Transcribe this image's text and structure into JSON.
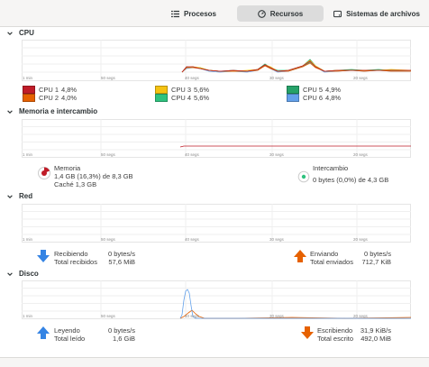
{
  "tabs": [
    {
      "label": "Procesos",
      "icon": "list-icon"
    },
    {
      "label": "Recursos",
      "icon": "gauge-icon"
    },
    {
      "label": "Sistemas de archivos",
      "icon": "disk-icon"
    }
  ],
  "axis_ticks": [
    "1 min",
    "50 segs",
    "40 segs",
    "30 segs",
    "20 segs",
    "10 segs"
  ],
  "cpu": {
    "title": "CPU",
    "cores": [
      {
        "label": "CPU 1",
        "value": "4,8%",
        "color": "#c01c28"
      },
      {
        "label": "CPU 2",
        "value": "4,0%",
        "color": "#e66100"
      },
      {
        "label": "CPU 3",
        "value": "5,6%",
        "color": "#f5c211"
      },
      {
        "label": "CPU 4",
        "value": "5,6%",
        "color": "#2ec27e"
      },
      {
        "label": "CPU 5",
        "value": "4,9%",
        "color": "#26a269"
      },
      {
        "label": "CPU 6",
        "value": "4,8%",
        "color": "#62a0ea"
      }
    ]
  },
  "memory": {
    "title": "Memoria e intercambio",
    "mem_label": "Memoria",
    "mem_value": "1,4 GB (16,3%) de 8,3 GB",
    "cache": "Caché 1,3 GB",
    "mem_color": "#c01c28",
    "swap_label": "Intercambio",
    "swap_value": "0 bytes (0,0%) de 4,3 GB",
    "swap_color": "#2ec27e"
  },
  "network": {
    "title": "Red",
    "recv_label": "Recibiendo",
    "recv_rate": "0 bytes/s",
    "recv_total_label": "Total recibidos",
    "recv_total": "57,6 MiB",
    "send_label": "Enviando",
    "send_rate": "0 bytes/s",
    "send_total_label": "Total enviados",
    "send_total": "712,7 KiB"
  },
  "disk": {
    "title": "Disco",
    "read_label": "Leyendo",
    "read_rate": "0 bytes/s",
    "read_total_label": "Total leído",
    "read_total": "1,6 GiB",
    "write_label": "Escribiendo",
    "write_rate": "31,9 KiB/s",
    "write_total_label": "Total escrito",
    "write_total": "492,0 MiB"
  },
  "colors": {
    "down_arrow": "#3584e4",
    "up_arrow": "#e66100"
  }
}
